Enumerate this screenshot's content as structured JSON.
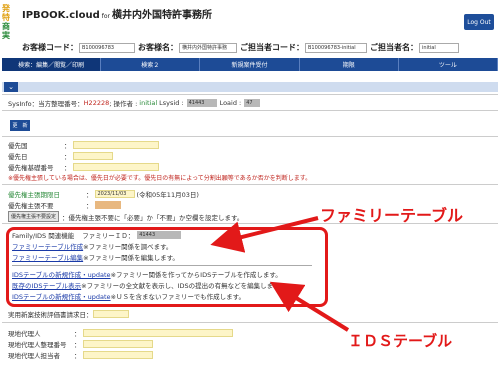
{
  "logo": {
    "line1": "発特",
    "line2": "商実"
  },
  "brand": {
    "app": "IPBOOK.cloud",
    "for": "for",
    "firm": "横井内外国特許事務所"
  },
  "logout": "Log Out",
  "header": {
    "client_code_label": "お客様コード：",
    "client_code_value": "B100096783",
    "client_name_label": "お客様名：",
    "client_name_value": "横井内外国特許事務",
    "staff_code_label": "ご担当者コード：",
    "staff_code_value": "B100096783-initial",
    "staff_name_label": "ご担当者名：",
    "staff_name_value": "initial"
  },
  "tabs": [
    "検索：編集／閲覧／印刷",
    "検索２",
    "新規案件受付",
    "期限",
    "ツール"
  ],
  "sysinfo": {
    "prefix": "SysInfo：当方整理番号：",
    "number": "H22228",
    "operator_label": "; 操作者 :",
    "operator": "initial",
    "lsysid_label": "Lsysid :",
    "lsysid": "41443",
    "loaid_label": "Loaid :",
    "loaid": "47"
  },
  "update_button": "更　新",
  "priority": {
    "country": "優先国",
    "date": "優先日",
    "number": "優先権基礎番号",
    "note": "※優先権主張している場合は、優先日が必要です。優先日の有無によって分割出願等であるか否かを判断します。"
  },
  "claim": {
    "deadline_label": "優先権主張期限日",
    "deadline_value": "2023/11/03",
    "deadline_reiwa": "(令和05年11月03日)",
    "unneeded_label": "優先権主張不要",
    "setting_button": "優先権主張不要設定",
    "setting_note": "：優先権主張不要に「必要」か「不要」か空欄を設定します。"
  },
  "family": {
    "title": "Family/IDS 関連機能",
    "id_label": "ファミリーＩＤ：",
    "id_value": "41443",
    "create_link": "ファミリーテーブル作成",
    "create_note": "※ファミリー関係を調べます。",
    "edit_link": "ファミリーテーブル編集",
    "edit_note": "※ファミリー関係を編集します。"
  },
  "ids": {
    "update_link1": "IDSテーブルの新規作成・update",
    "update_note1": "※ファミリー関係を作ってからIDSテーブルを作成します。",
    "show_link": "既存のIDSテーブル表示",
    "show_note": "※ファミリーの全文献を表示し、IDSの提出の有無などを編集します。",
    "update_link2": "IDSテーブルの新規作成・update",
    "update_note2": "※ＵＳを含まないファミリーでも作成します。"
  },
  "exam_request_label": "実用新案技術評価書請求日：",
  "agents": {
    "agent": "現地代理人",
    "ref": "現地代理人整理番号",
    "person": "現地代理人担当者"
  },
  "callouts": {
    "family_table": "ファミリーテーブル",
    "ids_table": "ＩＤＳテーブル"
  }
}
